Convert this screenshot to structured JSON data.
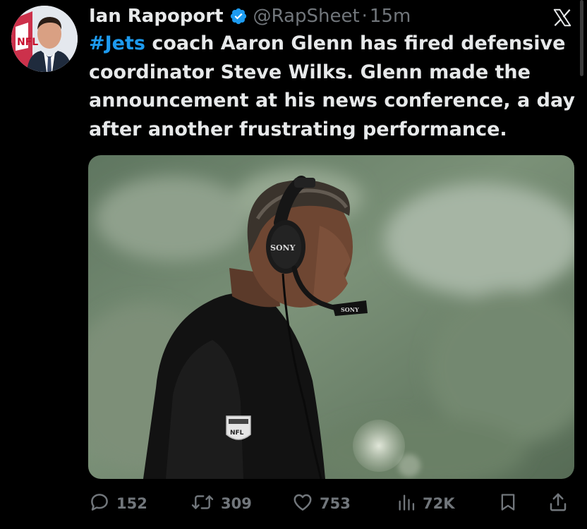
{
  "author": {
    "name": "Ian Rapoport",
    "handle": "@RapSheet",
    "separator": "·",
    "time": "15m",
    "avatar_badge": "NFL"
  },
  "tweet": {
    "hashtag": "#Jets",
    "body": " coach Aaron Glenn has fired defensive coordinator Steve Wilks. Glenn made the announcement at his news conference, a day after another frustrating performance."
  },
  "media": {
    "headset_brand": "SONY",
    "mic_brand": "SONY",
    "sleeve_logo": "NFL"
  },
  "actions": {
    "replies": "152",
    "reposts": "309",
    "likes": "753",
    "views": "72K"
  },
  "icons": {
    "verified": "verified-badge-icon",
    "platform": "x-logo-icon",
    "reply": "reply-icon",
    "repost": "repost-icon",
    "like": "like-icon",
    "views": "views-icon",
    "bookmark": "bookmark-icon",
    "share": "share-icon"
  },
  "colors": {
    "background": "#000000",
    "text": "#e7e9ea",
    "muted": "#71767b",
    "accent": "#1d9bf0"
  }
}
